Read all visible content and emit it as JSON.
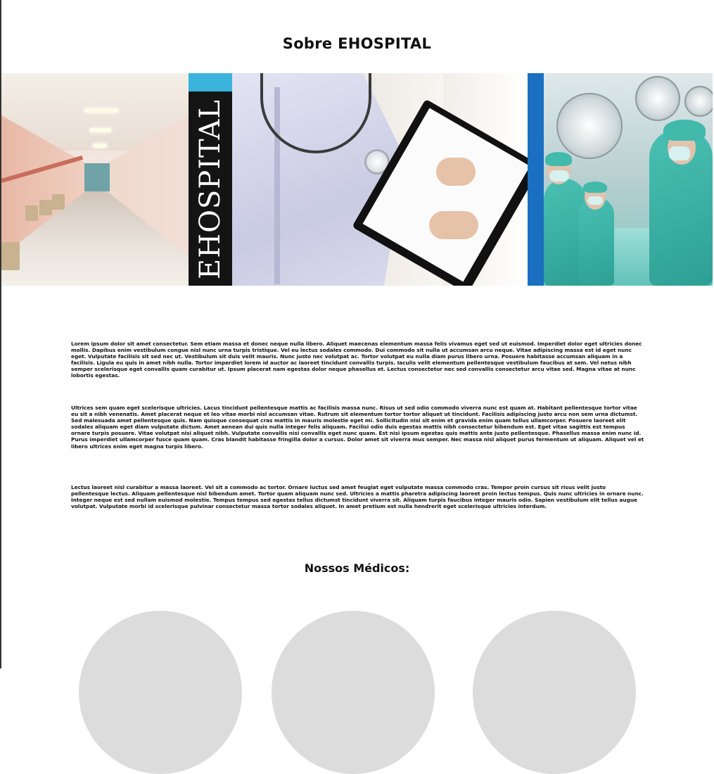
{
  "about": {
    "title": "Sobre EHOSPITAL",
    "banner_text": "EHOSPITAL",
    "paragraphs": [
      "Lorem ipsum dolor sit amet consectetur. Sem etiam massa et donec neque nulla libero. Aliquet maecenas elementum massa felis vivamus eget sed ut euismod. Imperdiet dolor eget ultricies donec mollis. Dapibus enim vestibulum congue nisl nunc urna turpis tristique. Vel eu lectus sodales commodo. Dui commodo sit nulla ut accumsan arcu neque. Vitae adipiscing massa est id eget nunc eget. Vulputate facilisis sit sed nec ut. Vestibulum sit duis velit mauris. Nunc justo nec volutpat ac. Tortor volutpat eu nulla diam purus libero urna. Posuere habitasse accumsan aliquam in a facilisis. Ligula eu quis in amet nibh nulla. Tortor imperdiet lorem id auctor ac laoreet tincidunt convallis turpis. Iaculis velit elementum pellentesque vestibulum faucibus at sem. Vel netus nibh semper scelerisque eget convallis quam curabitur ut. Ipsum placerat nam egestas dolor neque phasellus et. Lectus consectetur nec sed convallis consectetur arcu vitae sed. Magna vitae at nunc lobortis egestas.",
      "Ultrices sem quam eget scelerisque ultricies. Lacus tincidunt pellentesque mattis ac facilisis massa nunc. Risus ut sed odio commodo viverra nunc est quam at. Habitant pellentesque tortor vitae eu sit a nibh venenatis. Amet placerat neque et leo vitae morbi nisl accumsan vitae. Rutrum sit elementum tortor tortor aliquet ut tincidunt. Facilisis adipiscing justo arcu non sem urna dictumst. Sed malesuada amet pellentesque quis. Nam quisque consequat cras mattis in mauris molestie eget mi. Sollicitudin nisi sit enim et gravida enim quam tellus ullamcorper. Posuere laoreet elit sodales aliquam eget diam vulputate dictum. Amet aenean dui quis nulla integer felis aliquam. Facilisi odio duis egestas mattis nibh consectetur bibendum est. Eget vitae sagittis est tempus ornare turpis posuere. Vitae volutpat nisi aliquet nibh. Vulputate convallis nisi convallis eget nunc quam. Est nisi ipsum egestas quis mattis ante justo pellentesque. Phasellus massa enim nunc id. Purus imperdiet ullamcorper fusce quam quam. Cras blandit habitasse fringilla dolor a cursus. Dolor amet sit viverra mus semper. Nec massa nisl aliquet purus fermentum ut aliquam. Aliquet vel et libero ultrices enim eget magna turpis libero.",
      "Lectus laoreet nisl curabitur a massa laoreet. Vel sit a commodo ac tortor. Ornare luctus sed amet feugiat eget vulputate massa commodo cras. Tempor proin cursus sit risus velit justo pellentesque lectus. Aliquam pellentesque nisl bibendum amet. Tortor quam aliquam nunc sed. Ultricies a mattis pharetra adipiscing laoreet proin lectus tempus. Quis nunc ultricies in ornare nunc. Integer neque est sed nullam euismod molestie. Tempus tempus sed egestas tellus dictumst tincidunt viverra sit. Aliquam turpis faucibus integer mauris odio. Sapien vestibulum elit tellus augue volutpat. Vulputate morbi id scelerisque pulvinar consectetur massa tortor sodales aliquet. In amet pretium est nulla hendrerit eget scelerisque ultricies interdum."
    ]
  },
  "doctors": {
    "title": "Nossos Médicos:"
  }
}
